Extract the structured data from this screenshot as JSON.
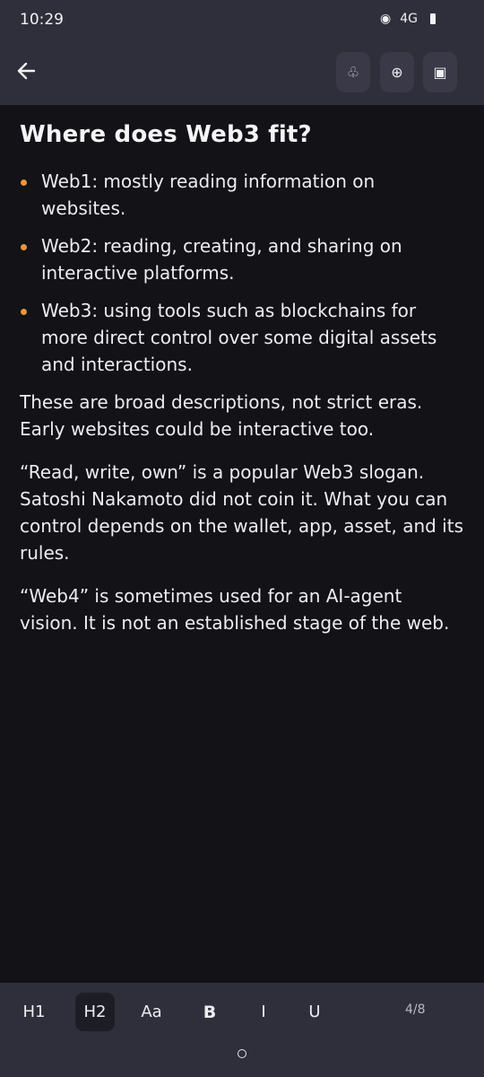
{
  "status_bar": {
    "time": "10:29",
    "signal_icon": "◉",
    "network": "4G",
    "battery_icon": "battery-icon"
  },
  "app_bar": {
    "back_icon": "arrow-left-icon",
    "tools": [
      {
        "name": "club",
        "glyph": "♧"
      },
      {
        "name": "add-circle",
        "glyph": "⊕"
      },
      {
        "name": "square",
        "glyph": "▣"
      }
    ]
  },
  "document": {
    "title": "Where does Web3 fit?",
    "bullets": [
      "Web1: mostly reading information on websites.",
      "Web2: reading, creating, and sharing on interactive platforms.",
      "Web3: using tools such as blockchains for more direct control over some digital assets and interactions."
    ],
    "paragraphs": [
      "These are broad descriptions, not strict eras. Early websites could be interactive too.",
      "“Read, write, own” is a popular Web3 slogan. Satoshi Nakamoto did not coin it. What you can control depends on the wallet, app, asset, and its rules.",
      "“Web4” is sometimes used for an AI-agent vision. It is not an established stage of the web."
    ]
  },
  "toolbar": {
    "h1": "H1",
    "h2": "H2",
    "aa": "Aa",
    "bold": "B",
    "italic": "I",
    "underline": "U",
    "active": "H2",
    "page": "4/8"
  },
  "colors": {
    "background": "#121217",
    "bars": "#2f2f3b",
    "bullet_accent": "#e8963c",
    "text": "#ededf1"
  }
}
